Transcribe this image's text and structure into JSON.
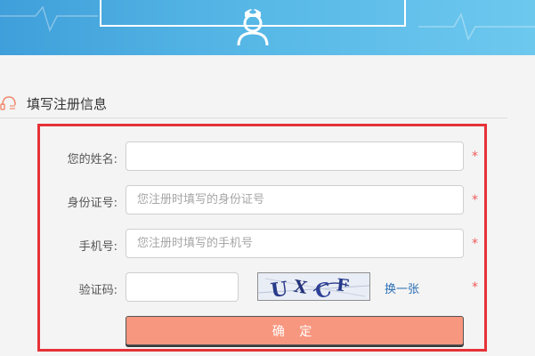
{
  "section": {
    "title": "填写注册信息"
  },
  "form": {
    "name_label": "您的姓名:",
    "name_value": "",
    "id_label": "身份证号:",
    "id_placeholder": "您注册时填写的身份证号",
    "phone_label": "手机号:",
    "phone_placeholder": "您注册时填写的手机号",
    "captcha_label": "验证码:",
    "captcha_value": "",
    "captcha_image_text": "UXCF",
    "refresh_label": "换一张",
    "required_mark": "*",
    "submit_label": "确 定"
  },
  "colors": {
    "banner": "#56b7e6",
    "highlight_border": "#e53238",
    "submit_bg": "#f8977f",
    "required": "#ee5a5a",
    "link": "#2b6fb5"
  },
  "icons": [
    "nurse-icon",
    "headset-icon"
  ]
}
